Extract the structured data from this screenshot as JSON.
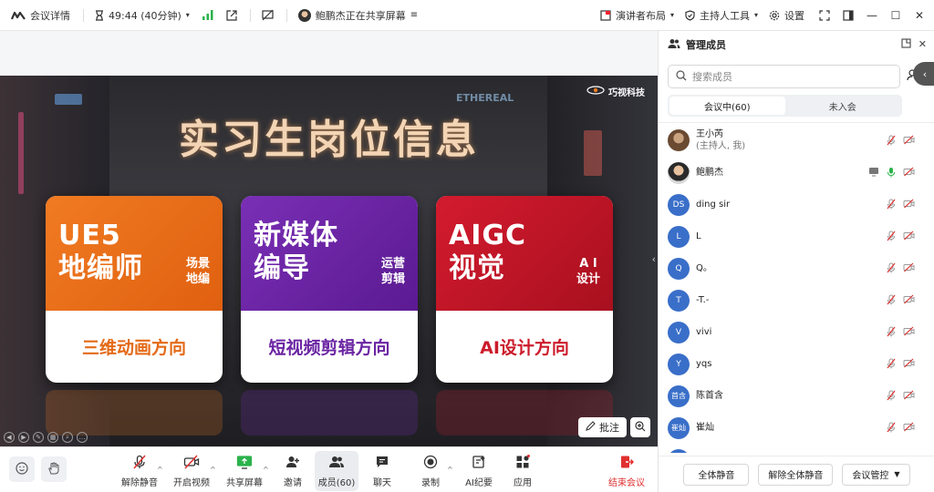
{
  "topbar": {
    "meeting_details": "会议详情",
    "timer": "49:44 (40分钟)",
    "share_status": "鲍鹏杰正在共享屏幕",
    "layout": "演讲者布局",
    "host_tools": "主持人工具",
    "settings": "设置"
  },
  "slide": {
    "title": "实习生岗位信息",
    "logo": "巧视科技",
    "sign_text": "ETHEREAL",
    "cards": [
      {
        "main": [
          "UE5",
          "地编师"
        ],
        "side": [
          "场景",
          "地编"
        ],
        "foot": "三维动画方向"
      },
      {
        "main": [
          "新媒体",
          "编导"
        ],
        "side": [
          "运营",
          "剪辑"
        ],
        "foot": "短视频剪辑方向"
      },
      {
        "main": [
          "AIGC",
          "视觉"
        ],
        "side": [
          "A I",
          "设计"
        ],
        "foot": "AI设计方向"
      }
    ],
    "annotate": "批注"
  },
  "toolbar": {
    "unmute": "解除静音",
    "start_video": "开启视频",
    "share_screen": "共享屏幕",
    "invite": "邀请",
    "members": "成员(60)",
    "chat": "聊天",
    "record": "录制",
    "ai_minutes": "AI纪要",
    "apps": "应用",
    "end": "结束会议"
  },
  "panel": {
    "title": "管理成员",
    "search_placeholder": "搜索成员",
    "tab_in_meeting": "会议中(60)",
    "tab_not_joined": "未入会",
    "members": [
      {
        "avatar": "",
        "name": "王小芮",
        "sub": "(主持人, 我)"
      },
      {
        "avatar": "",
        "name": "鲍鹏杰",
        "sub": ""
      },
      {
        "avatar": "DS",
        "name": "ding sir",
        "sub": ""
      },
      {
        "avatar": "L",
        "name": "L",
        "sub": ""
      },
      {
        "avatar": "Q",
        "name": "Q。",
        "sub": ""
      },
      {
        "avatar": "T",
        "name": "-T.-",
        "sub": ""
      },
      {
        "avatar": "V",
        "name": "vivi",
        "sub": ""
      },
      {
        "avatar": "Y",
        "name": "yqs",
        "sub": ""
      },
      {
        "avatar": "首含",
        "name": "陈首含",
        "sub": ""
      },
      {
        "avatar": "崔灿",
        "name": "崔灿",
        "sub": ""
      }
    ],
    "mute_all": "全体静音",
    "unmute_all": "解除全体静音",
    "meeting_control": "会议管控"
  },
  "colors": {
    "accent_blue": "#3a6fc9",
    "end_red": "#e02f2f",
    "card_orange": "#f07b22",
    "card_purple": "#7a2fb5",
    "card_red": "#d31b2e"
  }
}
